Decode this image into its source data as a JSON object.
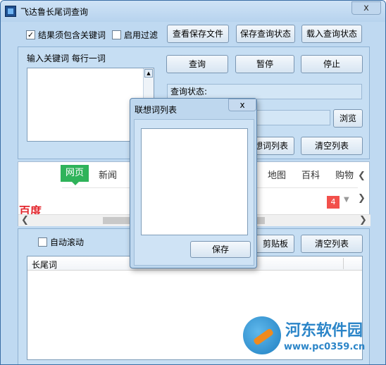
{
  "window": {
    "title": "飞达鲁长尾词查询",
    "close_glyph": "x"
  },
  "toolbar": {
    "check_must_contain": "结果须包含关键词",
    "check_must_contain_checked": "✓",
    "check_filter": "启用过滤",
    "btn_view_saved": "查看保存文件",
    "btn_save_state": "保存查询状态",
    "btn_load_state": "载入查询状态"
  },
  "input_panel": {
    "label": "输入关键词  每行一词",
    "btn_query": "查询",
    "btn_pause": "暂停",
    "btn_stop": "停止",
    "status_label": "查询状态:",
    "btn_browse": "浏览",
    "btn_word_list": "想词列表",
    "btn_clear_list": "清空列表"
  },
  "browser": {
    "tab_active": "网页",
    "tab_news": "新闻",
    "tab_map": "地图",
    "tab_baike": "百科",
    "tab_shopping": "购物",
    "logo": "百度",
    "badge": "4"
  },
  "results_panel": {
    "check_autoscroll": "自动滚动",
    "btn_clipboard": "剪贴板",
    "btn_clear_list": "清空列表",
    "col_header": "长尾词"
  },
  "dialog": {
    "title": "联想词列表",
    "close_glyph": "x",
    "btn_save": "保存"
  },
  "watermark": {
    "name": "河东软件园",
    "url": "www.pc0359.cn"
  },
  "colors": {
    "window_bg": "#bfd9f1",
    "accent_green": "#2fb35a",
    "baidu_red": "#e3262d"
  }
}
